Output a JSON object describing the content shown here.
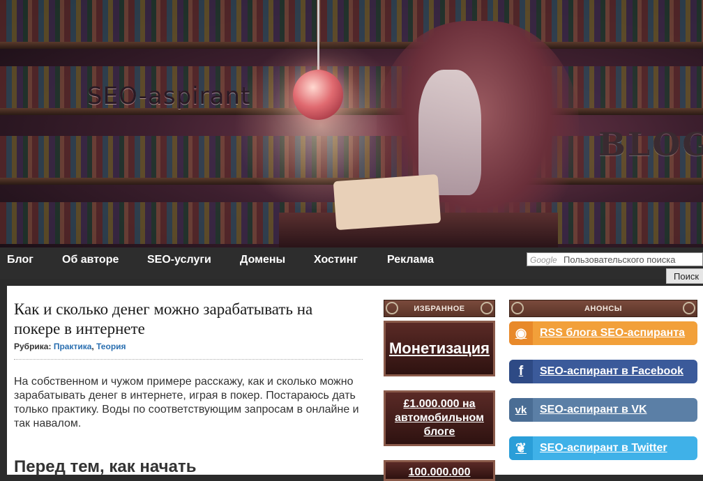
{
  "header": {
    "site_title": "SEO-aspirant",
    "blog_sign": "BLOG"
  },
  "nav": {
    "items": [
      {
        "label": "Блог"
      },
      {
        "label": "Об авторе"
      },
      {
        "label": "SEO-услуги"
      },
      {
        "label": "Домены"
      },
      {
        "label": "Хостинг"
      },
      {
        "label": "Реклама"
      }
    ],
    "search": {
      "brand": "Google",
      "placeholder": "Пользовательского поиска",
      "button": "Поиск"
    }
  },
  "article": {
    "title": "Как и сколько денег можно зарабатывать на покере в интернете",
    "meta_label": "Рубрика:",
    "categories": [
      "Практика",
      "Теория"
    ],
    "intro": "На собственном и чужом примере расскажу, как и сколько можно зарабатывать денег в интернете, играя в покер. Постараюсь дать только практику. Воды по соответствующим запросам в онлайне и так навалом.",
    "section_heading": "Перед тем, как начать"
  },
  "sidebar_favorites": {
    "heading": "ИЗБРАННОЕ",
    "items": [
      {
        "label": "Монетизация"
      },
      {
        "label": "£1.000.000 на автомобильном блоге"
      },
      {
        "label": "100.000.000"
      }
    ]
  },
  "sidebar_announcements": {
    "heading": "АНОНСЫ",
    "buttons": [
      {
        "label": "RSS блога SEO-аспиранта",
        "icon": "rss-icon",
        "color": "#f2a03a",
        "icon_color": "#e8892a"
      },
      {
        "label": "SEO-аспирант в Facebook",
        "icon": "facebook-icon",
        "color": "#3b5a9a",
        "icon_color": "#2e4a85"
      },
      {
        "label": "SEO-аспирант в VK",
        "icon": "vk-icon",
        "color": "#5b7fa6",
        "icon_color": "#4a6d94"
      },
      {
        "label": "SEO-аспирант в Twitter",
        "icon": "twitter-icon",
        "color": "#3fb1e8",
        "icon_color": "#2a9ed8"
      }
    ]
  }
}
